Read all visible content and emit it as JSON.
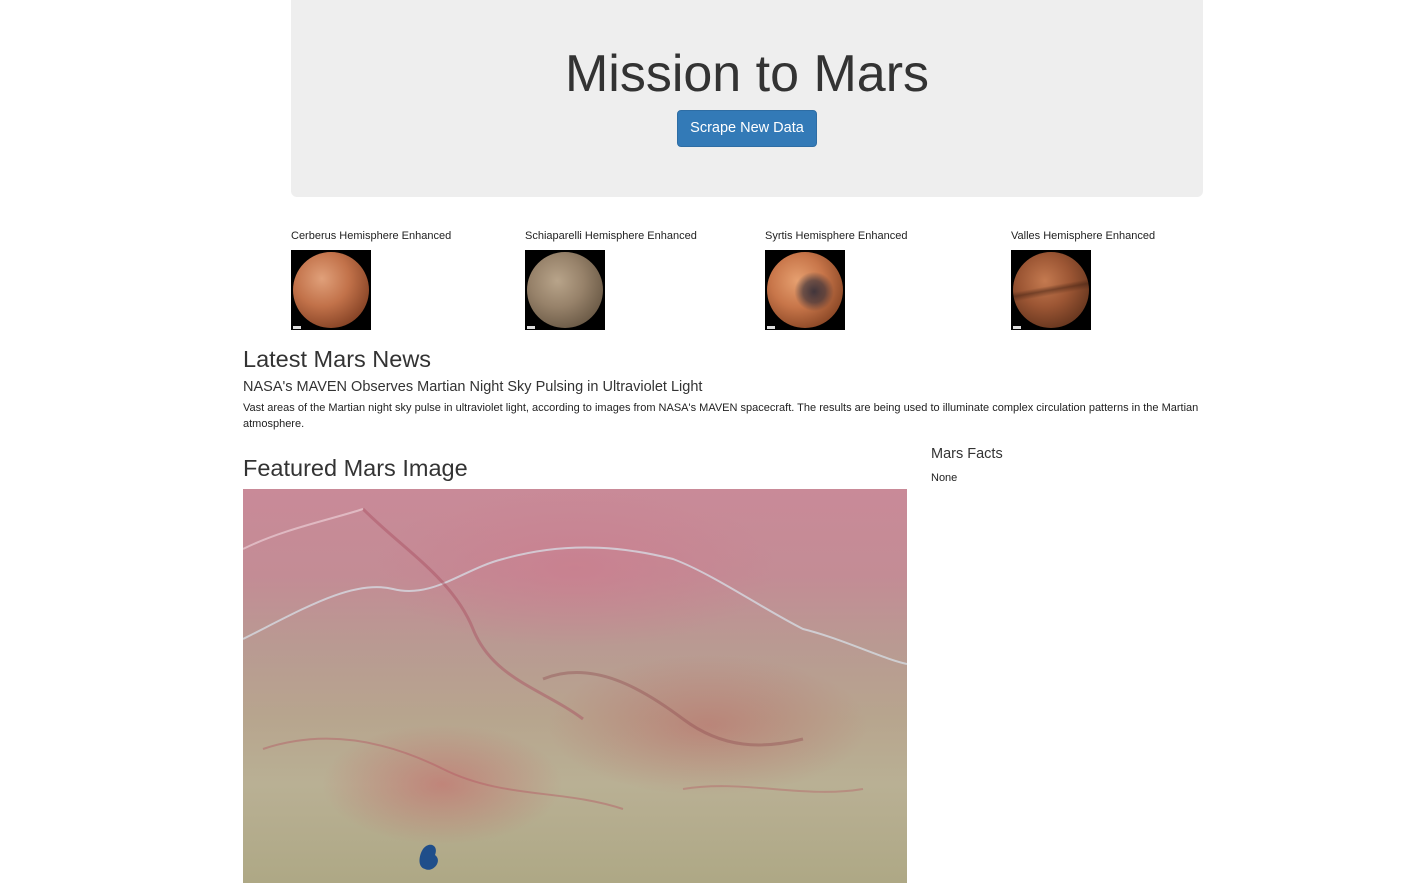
{
  "header": {
    "title": "Mission to Mars",
    "scrape_button_label": "Scrape New Data"
  },
  "hemispheres": [
    {
      "title": "Cerberus Hemisphere Enhanced"
    },
    {
      "title": "Schiaparelli Hemisphere Enhanced"
    },
    {
      "title": "Syrtis Hemisphere Enhanced"
    },
    {
      "title": "Valles Hemisphere Enhanced"
    }
  ],
  "news": {
    "section_title": "Latest Mars News",
    "headline": "NASA's MAVEN Observes Martian Night Sky Pulsing in Ultraviolet Light",
    "teaser": "Vast areas of the Martian night sky pulse in ultraviolet light, according to images from NASA's MAVEN spacecraft. The results are being used to illuminate complex circulation patterns in the Martian atmosphere."
  },
  "featured": {
    "section_title": "Featured Mars Image"
  },
  "facts": {
    "title": "Mars Facts",
    "content": "None"
  },
  "colors": {
    "jumbotron_bg": "#eeeeee",
    "button_primary": "#337ab7",
    "text": "#333333"
  }
}
